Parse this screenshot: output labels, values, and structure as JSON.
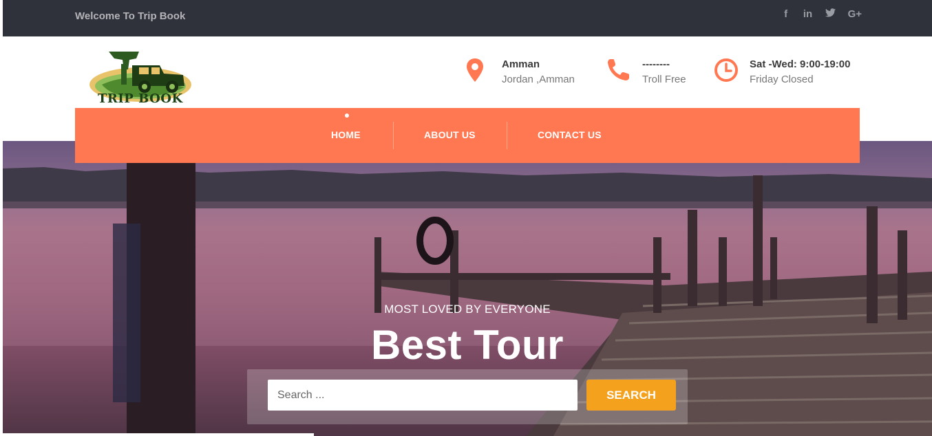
{
  "topbar": {
    "welcome": "Welcome To Trip Book",
    "social": [
      {
        "icon": "facebook-icon",
        "glyph": "f"
      },
      {
        "icon": "linkedin-icon",
        "glyph": "in"
      },
      {
        "icon": "twitter-icon",
        "glyph": "t"
      },
      {
        "icon": "google-plus-icon",
        "glyph": "G+"
      }
    ]
  },
  "header": {
    "logo_text": "TRIP BOOK",
    "contacts": [
      {
        "icon": "location-pin-icon",
        "title": "Amman",
        "subtitle": "Jordan ,Amman"
      },
      {
        "icon": "phone-icon",
        "title": "--------",
        "subtitle": "Troll Free"
      },
      {
        "icon": "clock-icon",
        "title": "Sat -Wed: 9:00-19:00",
        "subtitle": "Friday Closed"
      }
    ]
  },
  "nav": {
    "items": [
      {
        "label": "HOME",
        "active": true
      },
      {
        "label": "ABOUT US",
        "active": false
      },
      {
        "label": "CONTACT US",
        "active": false
      }
    ]
  },
  "hero": {
    "kicker": "MOST LOVED BY EVERYONE",
    "headline": "Best Tour",
    "search": {
      "placeholder": "Search ...",
      "value": "",
      "button_label": "SEARCH"
    }
  },
  "colors": {
    "topbar_bg": "#2f323b",
    "accent": "#ff7852",
    "search_button": "#f4a11e",
    "logo_green": "#1a3f16"
  }
}
